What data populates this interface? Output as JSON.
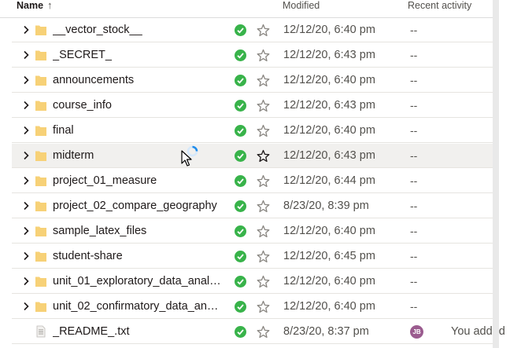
{
  "header": {
    "name_label": "Name",
    "sort_arrow": "↑",
    "modified_label": "Modified",
    "activity_label": "Recent activity"
  },
  "colors": {
    "folder": "#f7d177",
    "check": "#38b34a",
    "avatar": "#9b5c8f"
  },
  "rows": [
    {
      "name": "__vector_stock__",
      "modified": "12/12/20, 6:40 pm",
      "activity": "--",
      "type": "folder"
    },
    {
      "name": "_SECRET_",
      "modified": "12/12/20, 6:43 pm",
      "activity": "--",
      "type": "folder"
    },
    {
      "name": "announcements",
      "modified": "12/12/20, 6:40 pm",
      "activity": "--",
      "type": "folder"
    },
    {
      "name": "course_info",
      "modified": "12/12/20, 6:43 pm",
      "activity": "--",
      "type": "folder"
    },
    {
      "name": "final",
      "modified": "12/12/20, 6:40 pm",
      "activity": "--",
      "type": "folder"
    },
    {
      "name": "midterm",
      "modified": "12/12/20, 6:43 pm",
      "activity": "--",
      "type": "folder",
      "hover": true
    },
    {
      "name": "project_01_measure",
      "modified": "12/12/20, 6:44 pm",
      "activity": "--",
      "type": "folder"
    },
    {
      "name": "project_02_compare_geography",
      "modified": "8/23/20, 8:39 pm",
      "activity": "--",
      "type": "folder"
    },
    {
      "name": "sample_latex_files",
      "modified": "12/12/20, 6:40 pm",
      "activity": "--",
      "type": "folder"
    },
    {
      "name": "student-share",
      "modified": "12/12/20, 6:45 pm",
      "activity": "--",
      "type": "folder"
    },
    {
      "name": "unit_01_exploratory_data_analy…",
      "modified": "12/12/20, 6:40 pm",
      "activity": "--",
      "type": "folder"
    },
    {
      "name": "unit_02_confirmatory_data_an…",
      "modified": "12/12/20, 6:40 pm",
      "activity": "--",
      "type": "folder"
    },
    {
      "name": "_README_.txt",
      "modified": "8/23/20, 8:37 pm",
      "activity": "You added",
      "avatar": "JB",
      "type": "file"
    }
  ]
}
